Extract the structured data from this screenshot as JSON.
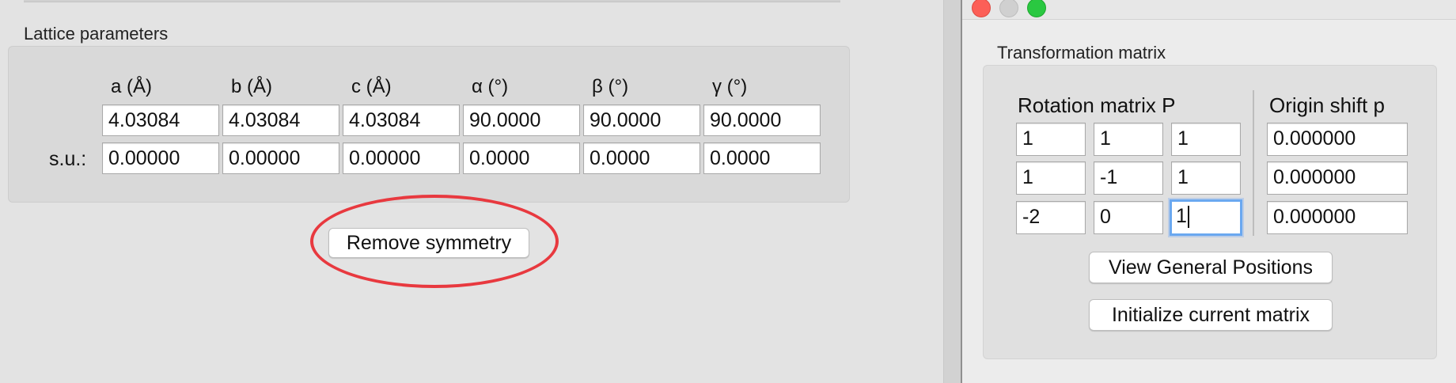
{
  "lattice": {
    "title": "Lattice parameters",
    "headers": [
      "a (Å)",
      "b (Å)",
      "c (Å)",
      "α (°)",
      "β (°)",
      "γ (°)"
    ],
    "values": [
      "4.03084",
      "4.03084",
      "4.03084",
      "90.0000",
      "90.0000",
      "90.0000"
    ],
    "su_label": "s.u.:",
    "su_values": [
      "0.00000",
      "0.00000",
      "0.00000",
      "0.0000",
      "0.0000",
      "0.0000"
    ]
  },
  "remove_symmetry_label": "Remove symmetry",
  "annotation": {
    "color": "#e8393f"
  },
  "transformation": {
    "title": "Transformation matrix",
    "rotation_header": "Rotation matrix P",
    "origin_header": "Origin shift p",
    "rows": [
      {
        "rotation": [
          "1",
          "1",
          "1"
        ],
        "origin": "0.000000"
      },
      {
        "rotation": [
          "1",
          "-1",
          "1"
        ],
        "origin": "0.000000"
      },
      {
        "rotation": [
          "-2",
          "0",
          "1"
        ],
        "origin": "0.000000"
      }
    ],
    "view_general_positions_label": "View General Positions",
    "initialize_label": "Initialize current matrix"
  },
  "window_controls": {
    "close_color": "#fc5f57",
    "minimize_color": "#d0d0d0",
    "zoom_color": "#2ac841"
  },
  "focus_color": "#6aa8f0"
}
